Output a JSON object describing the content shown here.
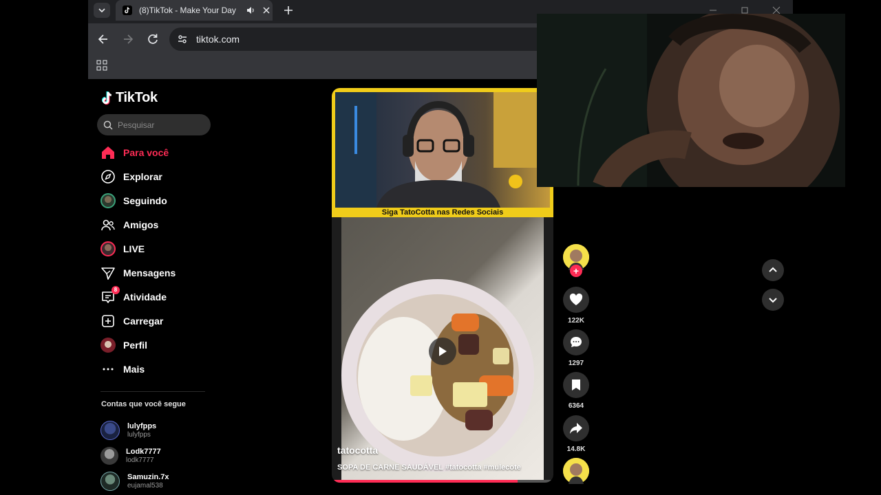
{
  "browser": {
    "tab": {
      "title": "(8)TikTok - Make Your Day"
    },
    "url": "tiktok.com"
  },
  "tiktok": {
    "logo_text": "TikTok",
    "search": {
      "placeholder": "Pesquisar"
    },
    "nav": [
      {
        "label": "Para você",
        "icon": "home-icon",
        "active": true
      },
      {
        "label": "Explorar",
        "icon": "compass-icon"
      },
      {
        "label": "Seguindo",
        "icon": "following-avatar"
      },
      {
        "label": "Amigos",
        "icon": "friends-icon"
      },
      {
        "label": "LIVE",
        "icon": "live-avatar"
      },
      {
        "label": "Mensagens",
        "icon": "send-icon"
      },
      {
        "label": "Atividade",
        "icon": "inbox-icon",
        "badge": "8"
      },
      {
        "label": "Carregar",
        "icon": "upload-icon"
      },
      {
        "label": "Perfil",
        "icon": "profile-avatar"
      },
      {
        "label": "Mais",
        "icon": "more-icon"
      }
    ],
    "following_title": "Contas que você segue",
    "following": [
      {
        "name": "lulyfpps",
        "username": "lulyfpps"
      },
      {
        "name": "Lodk7777",
        "username": "lodk7777"
      },
      {
        "name": "Samuzin.7x",
        "username": "eujamal538"
      }
    ],
    "video": {
      "banner_prefix": "Siga TatoCotta nas ",
      "banner_highlight": "Redes Sociais",
      "author": "tatocotta",
      "description": "SOPA DE CARNE SAUDÁVEL #tatocotta #mulecote",
      "progress": 0.84
    },
    "actions": {
      "likes": "122K",
      "comments": "1297",
      "saves": "6364",
      "shares": "14.8K"
    }
  },
  "colors": {
    "accent": "#fe2c55",
    "banner_yellow": "#f0cc1a"
  }
}
